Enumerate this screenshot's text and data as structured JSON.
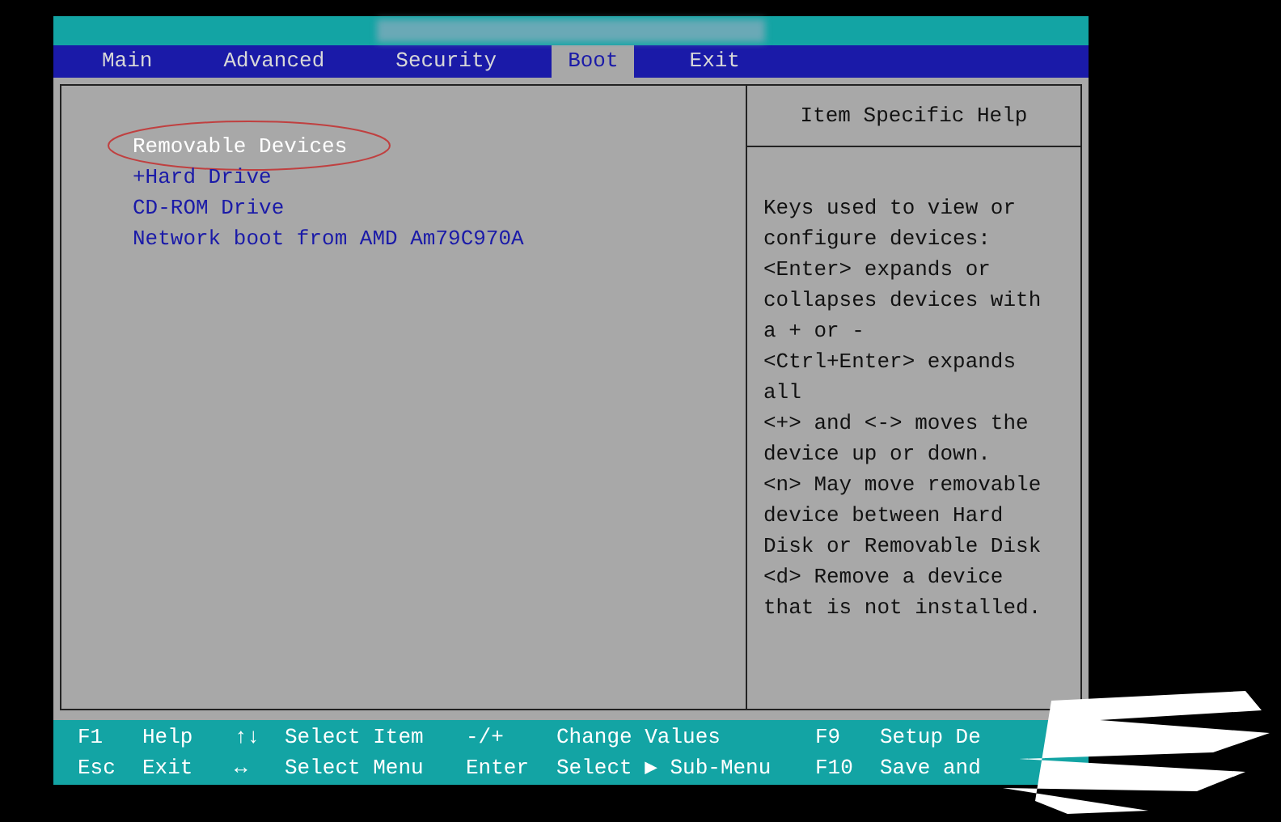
{
  "menu": [
    {
      "label": "Main",
      "selected": false
    },
    {
      "label": "Advanced",
      "selected": false
    },
    {
      "label": "Security",
      "selected": false
    },
    {
      "label": "Boot",
      "selected": true
    },
    {
      "label": "Exit",
      "selected": false
    }
  ],
  "boot_items": [
    {
      "label": "Removable Devices",
      "selected": true,
      "circled": true
    },
    {
      "label": "+Hard Drive",
      "selected": false,
      "circled": false
    },
    {
      "label": "CD-ROM Drive",
      "selected": false,
      "circled": false
    },
    {
      "label": "Network boot from AMD Am79C970A",
      "selected": false,
      "circled": false
    }
  ],
  "help": {
    "title": "Item Specific Help",
    "lines": [
      "Keys used to view or",
      "configure devices:",
      "<Enter> expands or",
      "collapses devices with",
      "a + or -",
      "<Ctrl+Enter> expands",
      "all",
      "<+> and <-> moves the",
      "device up or down.",
      "<n> May move removable",
      "device between Hard",
      "Disk or Removable Disk",
      "<d> Remove a device",
      "that is not installed."
    ]
  },
  "footer": [
    [
      {
        "key": "F1",
        "action": "Help"
      },
      {
        "key": "↑↓",
        "action": "Select Item"
      },
      {
        "key": "-/+",
        "action": "Change Values"
      },
      {
        "key": "F9",
        "action": "Setup De"
      }
    ],
    [
      {
        "key": "Esc",
        "action": "Exit"
      },
      {
        "key": "↔",
        "action": "Select Menu"
      },
      {
        "key": "Enter",
        "action": "Select ▶ Sub-Menu"
      },
      {
        "key": "F10",
        "action": "Save and"
      }
    ]
  ]
}
